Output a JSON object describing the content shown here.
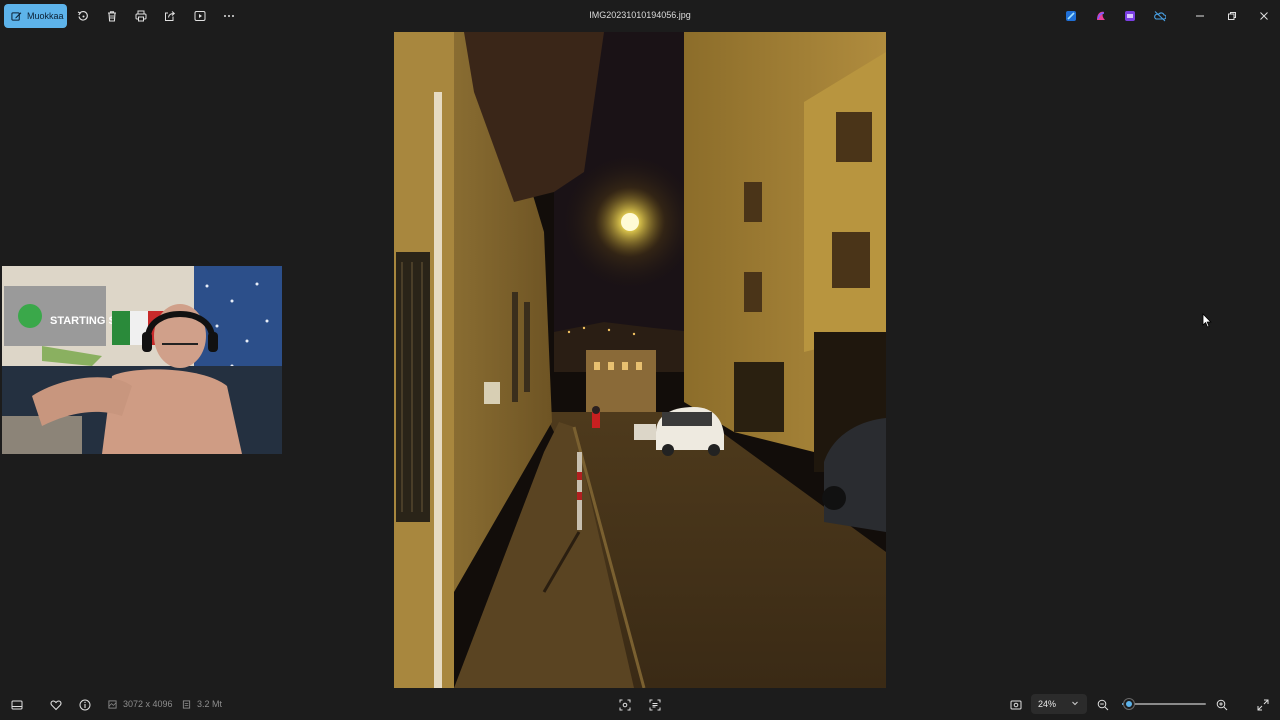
{
  "toolbar": {
    "edit_label": "Muokkaa",
    "icons": [
      "rotate-icon",
      "delete-icon",
      "print-icon",
      "share-icon",
      "slideshow-icon",
      "more-icon"
    ]
  },
  "window": {
    "title": "IMG20231010194056.jpg"
  },
  "app_icons": [
    "designer-icon",
    "copilot-icon",
    "clipchamp-icon",
    "onedrive-icon"
  ],
  "status_bar": {
    "dimensions": "3072 x 4096",
    "file_size": "3.2 Mt",
    "zoom_value": "24%",
    "zoom_fraction": 0.02
  },
  "webcam": {
    "poster_text": "STARTING SOON"
  },
  "colors": {
    "accent": "#5db3ea",
    "background": "#1c1c1c"
  }
}
